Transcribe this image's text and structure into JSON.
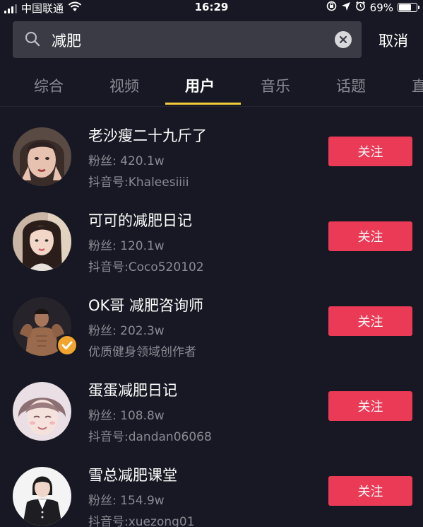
{
  "status_bar": {
    "carrier": "中国联通",
    "time": "16:29",
    "battery": "69%",
    "battery_level": 0.69,
    "icons": [
      "signal-icon",
      "wifi-icon",
      "orientation-lock-icon",
      "location-icon",
      "alarm-icon",
      "battery-icon"
    ]
  },
  "search": {
    "query": "减肥",
    "cancel_label": "取消",
    "icons": [
      "search-icon",
      "clear-icon"
    ]
  },
  "tabs": [
    {
      "label": "综合"
    },
    {
      "label": "视频"
    },
    {
      "label": "用户"
    },
    {
      "label": "音乐"
    },
    {
      "label": "话题"
    },
    {
      "label": "直"
    }
  ],
  "active_tab": "用户",
  "colors": {
    "background": "#171823",
    "accent": "#f2cb3b",
    "follow_button": "#ea3a56",
    "verified_badge": "#f3a42c"
  },
  "users": [
    {
      "name": "老沙瘦二十九斤了",
      "fans": "粉丝: 420.1w",
      "subtitle": "抖音号:Khaleesiiii",
      "follow_label": "关注",
      "verified": false
    },
    {
      "name": "可可的减肥日记",
      "fans": "粉丝: 120.1w",
      "subtitle": "抖音号:Coco520102",
      "follow_label": "关注",
      "verified": false
    },
    {
      "name": "OK哥 减肥咨询师",
      "fans": "粉丝: 202.3w",
      "subtitle": "优质健身领域创作者",
      "follow_label": "关注",
      "verified": true
    },
    {
      "name": "蛋蛋减肥日记",
      "fans": "粉丝: 108.8w",
      "subtitle": "抖音号:dandan06068",
      "follow_label": "关注",
      "verified": false
    },
    {
      "name": "雪总减肥课堂",
      "fans": "粉丝: 154.9w",
      "subtitle": "抖音号:xuezong01",
      "follow_label": "关注",
      "verified": false
    }
  ]
}
